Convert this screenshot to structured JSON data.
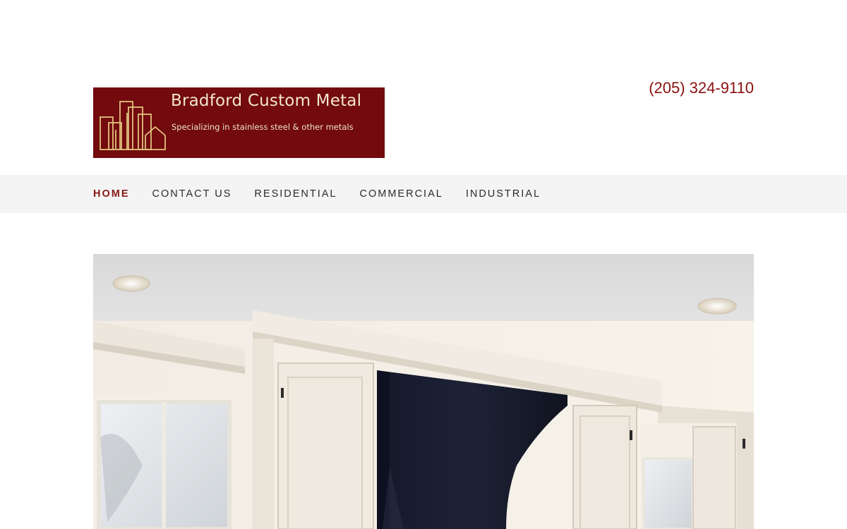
{
  "brand": {
    "name": "Bradford Custom Metal",
    "tagline": "Specializing in stainless steel & other metals",
    "color": "#720a0e"
  },
  "header": {
    "phone": "(205) 324-9110"
  },
  "nav": {
    "items": [
      {
        "label": "HOME",
        "active": true
      },
      {
        "label": "CONTACT US",
        "active": false
      },
      {
        "label": "RESIDENTIAL",
        "active": false
      },
      {
        "label": "COMMERCIAL",
        "active": false
      },
      {
        "label": "INDUSTRIAL",
        "active": false
      }
    ]
  },
  "hero": {
    "image": "kitchen-range-hood-photo"
  },
  "colors": {
    "accent": "#8a1010",
    "nav_bg": "#f4f4f4"
  }
}
